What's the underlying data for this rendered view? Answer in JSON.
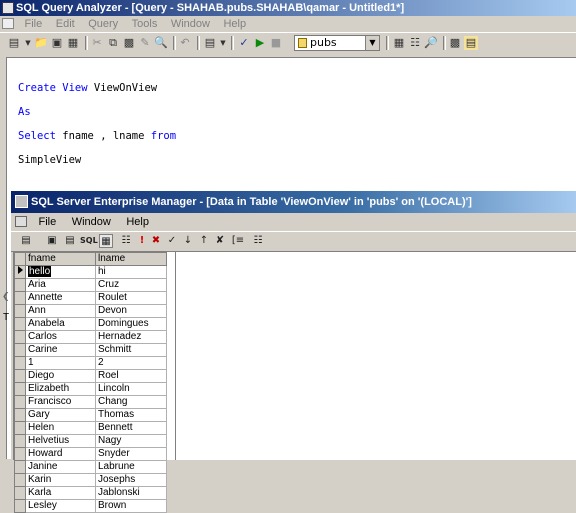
{
  "qa": {
    "title": "SQL Query Analyzer - [Query - SHAHAB.pubs.SHAHAB\\qamar - Untitled1*]",
    "menu": [
      "File",
      "Edit",
      "Query",
      "Tools",
      "Window",
      "Help"
    ],
    "database": "pubs",
    "code": {
      "l1_kw": "Create View",
      "l1_rest": " ViewOnView",
      "l2_kw": "As",
      "l3_kw1": "Select",
      "l3_mid": " fname , lname ",
      "l3_kw2": "from",
      "l4": "SimpleView"
    },
    "side_letter": "T"
  },
  "em": {
    "title": "SQL Server Enterprise Manager - [Data in Table 'ViewOnView' in 'pubs' on '(LOCAL)']",
    "menu": [
      "File",
      "Window",
      "Help"
    ],
    "toolbar_sql": "SQL"
  },
  "grid": {
    "columns": [
      "fname",
      "lname"
    ],
    "rows": [
      [
        "hello",
        "hi"
      ],
      [
        "Aria",
        "Cruz"
      ],
      [
        "Annette",
        "Roulet"
      ],
      [
        "Ann",
        "Devon"
      ],
      [
        "Anabela",
        "Domingues"
      ],
      [
        "Carlos",
        "Hernadez"
      ],
      [
        "Carine",
        "Schmitt"
      ],
      [
        "1",
        "2"
      ],
      [
        "Diego",
        "Roel"
      ],
      [
        "Elizabeth",
        "Lincoln"
      ],
      [
        "Francisco",
        "Chang"
      ],
      [
        "Gary",
        "Thomas"
      ],
      [
        "Helen",
        "Bennett"
      ],
      [
        "Helvetius",
        "Nagy"
      ],
      [
        "Howard",
        "Snyder"
      ],
      [
        "Janine",
        "Labrune"
      ],
      [
        "Karin",
        "Josephs"
      ],
      [
        "Karla",
        "Jablonski"
      ],
      [
        "Lesley",
        "Brown"
      ]
    ]
  },
  "colors": {
    "keyword": "#0000ff",
    "titlebar": "#0a246a",
    "chrome": "#d4d0c8"
  }
}
